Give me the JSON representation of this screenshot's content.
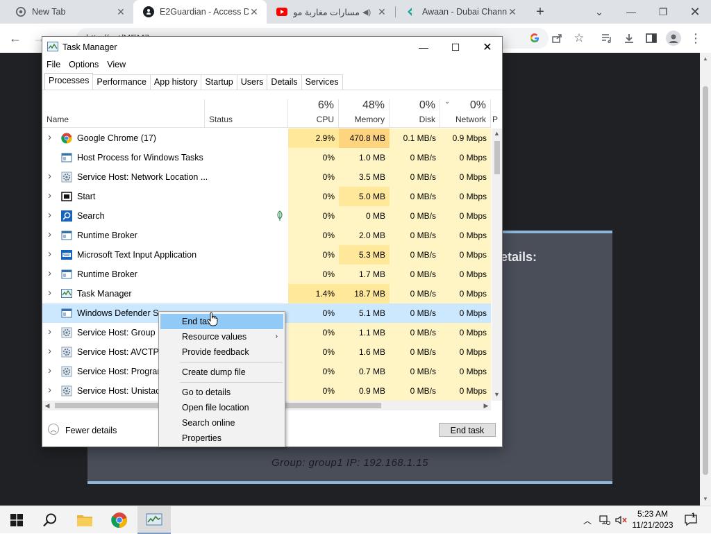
{
  "browser": {
    "tabs": [
      {
        "title": "New Tab",
        "icon": "chrome-icon",
        "active": false
      },
      {
        "title": "E2Guardian - Access D",
        "icon": "github-icon",
        "active": true
      },
      {
        "title": "مسارات مغاربة مو",
        "icon": "youtube-icon",
        "active": false
      },
      {
        "title": "Awaan - Dubai Chann",
        "icon": "awaan-icon",
        "active": false
      }
    ],
    "address": "http://ext/MEM7..."
  },
  "page": {
    "details_heading": "etails:",
    "group_line": "Group: group1   IP: 192.168.1.15"
  },
  "task_manager": {
    "title": "Task Manager",
    "menu": [
      "File",
      "Options",
      "View"
    ],
    "tabs": [
      "Processes",
      "Performance",
      "App history",
      "Startup",
      "Users",
      "Details",
      "Services"
    ],
    "active_tab": "Processes",
    "columns": {
      "name": "Name",
      "status": "Status",
      "cpu": {
        "pct": "6%",
        "label": "CPU"
      },
      "memory": {
        "pct": "48%",
        "label": "Memory"
      },
      "disk": {
        "pct": "0%",
        "label": "Disk"
      },
      "network": {
        "pct": "0%",
        "label": "Network"
      },
      "power": "P"
    },
    "processes": [
      {
        "name": "Google Chrome (17)",
        "expand": true,
        "icon": "chrome-icon",
        "cpu": "2.9%",
        "memory": "470.8 MB",
        "disk": "0.1 MB/s",
        "network": "0.9 Mbps"
      },
      {
        "name": "Host Process for Windows Tasks",
        "expand": false,
        "icon": "window-icon",
        "cpu": "0%",
        "memory": "1.0 MB",
        "disk": "0 MB/s",
        "network": "0 Mbps"
      },
      {
        "name": "Service Host: Network Location ...",
        "expand": true,
        "icon": "gear-icon",
        "cpu": "0%",
        "memory": "3.5 MB",
        "disk": "0 MB/s",
        "network": "0 Mbps"
      },
      {
        "name": "Start",
        "expand": true,
        "icon": "start-icon",
        "cpu": "0%",
        "memory": "5.0 MB",
        "disk": "0 MB/s",
        "network": "0 Mbps"
      },
      {
        "name": "Search",
        "expand": true,
        "icon": "search-icon",
        "status": "suspended-leaf-icon",
        "cpu": "0%",
        "memory": "0 MB",
        "disk": "0 MB/s",
        "network": "0 Mbps"
      },
      {
        "name": "Runtime Broker",
        "expand": true,
        "icon": "window-icon",
        "cpu": "0%",
        "memory": "2.0 MB",
        "disk": "0 MB/s",
        "network": "0 Mbps"
      },
      {
        "name": "Microsoft Text Input Application",
        "expand": true,
        "icon": "input-app-icon",
        "cpu": "0%",
        "memory": "5.3 MB",
        "disk": "0 MB/s",
        "network": "0 Mbps"
      },
      {
        "name": "Runtime Broker",
        "expand": true,
        "icon": "window-icon",
        "cpu": "0%",
        "memory": "1.7 MB",
        "disk": "0 MB/s",
        "network": "0 Mbps"
      },
      {
        "name": "Task Manager",
        "expand": true,
        "icon": "taskmgr-icon",
        "cpu": "1.4%",
        "memory": "18.7 MB",
        "disk": "0 MB/s",
        "network": "0 Mbps"
      },
      {
        "name": "Windows Defender Sm",
        "expand": false,
        "icon": "window-icon",
        "selected": true,
        "cpu": "0%",
        "memory": "5.1 MB",
        "disk": "0 MB/s",
        "network": "0 Mbps"
      },
      {
        "name": "Service Host: Group Pe",
        "expand": true,
        "icon": "gear-icon",
        "cpu": "0%",
        "memory": "1.1 MB",
        "disk": "0 MB/s",
        "network": "0 Mbps"
      },
      {
        "name": "Service Host: AVCTP se",
        "expand": true,
        "icon": "gear-icon",
        "cpu": "0%",
        "memory": "1.6 MB",
        "disk": "0 MB/s",
        "network": "0 Mbps"
      },
      {
        "name": "Service Host: Program",
        "expand": true,
        "icon": "gear-icon",
        "cpu": "0%",
        "memory": "0.7 MB",
        "disk": "0 MB/s",
        "network": "0 Mbps"
      },
      {
        "name": "Service Host: Unistack",
        "expand": true,
        "icon": "gear-icon",
        "cpu": "0%",
        "memory": "0.9 MB",
        "disk": "0 MB/s",
        "network": "0 Mbps"
      }
    ],
    "footer": {
      "fewer_details": "Fewer details",
      "end_task": "End task"
    }
  },
  "context_menu": {
    "items": [
      {
        "label": "End task",
        "highlighted": true
      },
      {
        "label": "Resource values",
        "submenu": true
      },
      {
        "label": "Provide feedback"
      },
      {
        "separator": true
      },
      {
        "label": "Create dump file"
      },
      {
        "separator": true
      },
      {
        "label": "Go to details"
      },
      {
        "label": "Open file location"
      },
      {
        "label": "Search online"
      },
      {
        "label": "Properties"
      }
    ]
  },
  "taskbar": {
    "time": "5:23 AM",
    "date": "11/21/2023",
    "notification_count": "1"
  },
  "colors": {
    "heat_low": "#fff4c4",
    "heat_mid": "#ffe89a",
    "heat_high": "#ffd47f",
    "selection": "#cce8ff",
    "menu_highlight": "#91c9f7"
  }
}
